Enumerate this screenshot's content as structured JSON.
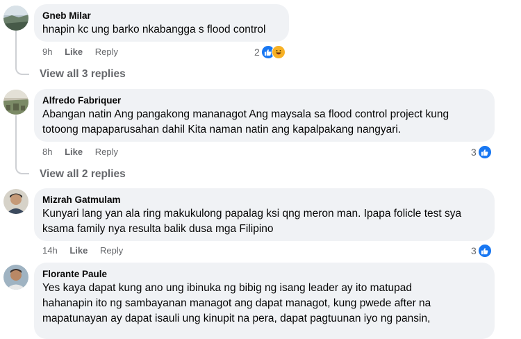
{
  "comments": [
    {
      "author": "Gneb Milar",
      "text": "hnapin kc ung barko nkabangga s flood control",
      "time": "9h",
      "like_label": "Like",
      "reply_label": "Reply",
      "reaction_count": "2",
      "reactions": [
        "like-icon",
        "haha-icon"
      ],
      "view_replies": "View all 3 replies"
    },
    {
      "author": "Alfredo Fabriquer",
      "text": "Abangan natin Ang pangakong mananagot Ang maysala sa flood control project kung\ntotoong mapaparusahan dahil Kita naman natin ang kapalpakang nangyari.",
      "time": "8h",
      "like_label": "Like",
      "reply_label": "Reply",
      "reaction_count": "3",
      "reactions": [
        "like-icon"
      ],
      "view_replies": "View all 2 replies"
    },
    {
      "author": "Mizrah Gatmulam",
      "text": "Kunyari lang yan ala ring makukulong papalag ksi qng meron man. Ipapa folicle test sya\nksama family nya resulta balik dusa mga Filipino",
      "time": "14h",
      "like_label": "Like",
      "reply_label": "Reply",
      "reaction_count": "3",
      "reactions": [
        "like-icon"
      ]
    },
    {
      "author": "Florante Paule",
      "text": "Yes kaya dapat kung ano ung ibinuka ng bibig ng isang leader ay ito matupad\nhahanapin ito ng sambayanan managot ang dapat managot, kung pwede after na\nmapatunayan ay dapat isauli ung kinupit na pera, dapat pagtuunan iyo ng pansin,"
    }
  ],
  "colors": {
    "bubble": "#f0f2f5",
    "meta_text": "#65676b",
    "like_blue": "#1877f2",
    "haha_yellow": "#f7b125"
  }
}
